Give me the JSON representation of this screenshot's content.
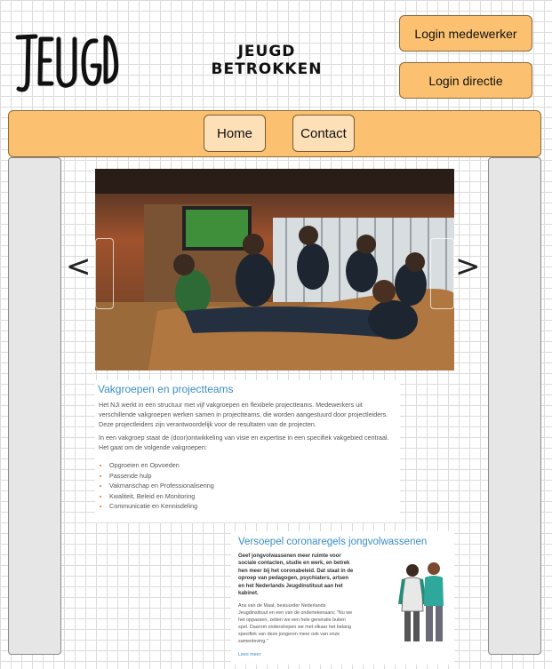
{
  "brand": {
    "logo_text": "JEUGD",
    "title_line1": "JEUGD",
    "title_line2": "BETROKKEN"
  },
  "header": {
    "login_staff": "Login medewerker",
    "login_management": "Login directie"
  },
  "nav": {
    "home": "Home",
    "contact": "Contact"
  },
  "carousel": {
    "prev_arrow": "<",
    "next_arrow": ">",
    "image_icon": "youth-lounge-photo"
  },
  "article1": {
    "title": "Vakgroepen en projectteams",
    "p1": "Het NJi werkt in een structuur met vijf vakgroepen en flexibele projectteams. Medewerkers uit verschillende vakgroepen werken samen in projectteams, die worden aangestuurd door projectleiders. Deze projectleiders zijn verantwoordelijk voor de resultaten van de projecten.",
    "p2": "In een vakgroep staat de (door)ontwikkeling van visie en expertise in een specifiek vakgebied centraal. Het gaat om de volgende vakgroepen:",
    "list": [
      "Opgroeien en Opvoeden",
      "Passende hulp",
      "Vakmanschap en Professionalisering",
      "Kwaliteit, Beleid en Monitoring",
      "Communicatie en Kennisdeling"
    ]
  },
  "article2": {
    "title": "Versoepel coronaregels jongvolwassenen",
    "lead": "Geef jongvolwassenen meer ruimte voor sociale contacten, studie en werk, en betrek hen meer bij het coronabeleid. Dat staat in de oproep van pedagogen, psychiaters, artsen en het Nederlands Jeugdinstituut aan het kabinet.",
    "body": "Ans van de Maat, bestuurder Nederlands Jeugdinstituut en een van de ondertekenaars: \"Nu we het oppassen, zetten we een hele generatie buiten spel. Daarom onderstrepen we met elkaar het belang specifiek van deze jongeren meer ook van onze samenleving.\"",
    "more": "Lees meer",
    "image_icon": "two-young-people-illustration"
  },
  "colors": {
    "accent": "#fbc170",
    "accent_light": "#fde0b8",
    "link": "#3a8ec4",
    "bullet": "#e07020"
  }
}
